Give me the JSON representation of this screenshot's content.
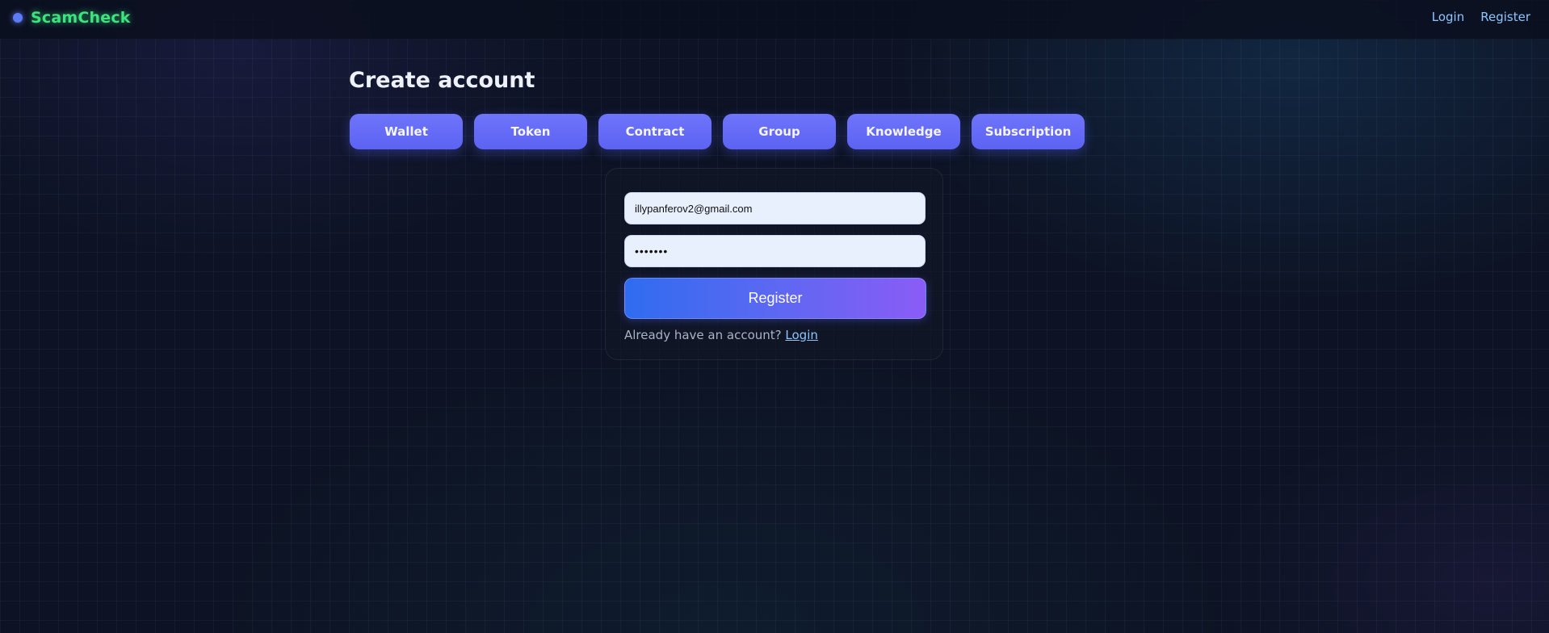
{
  "brand": {
    "name": "ScamCheck",
    "dot_color": "#5b7cf6",
    "name_color": "#3ee27f"
  },
  "nav": {
    "login_label": "Login",
    "register_label": "Register"
  },
  "page": {
    "title": "Create account"
  },
  "tabs": [
    {
      "label": "Wallet"
    },
    {
      "label": "Token"
    },
    {
      "label": "Contract"
    },
    {
      "label": "Group"
    },
    {
      "label": "Knowledge"
    },
    {
      "label": "Subscription"
    }
  ],
  "form": {
    "email_value": "illypanferov2@gmail.com",
    "password_value": "•••••••",
    "submit_label": "Register",
    "login_prompt_text": "Already have an account?",
    "login_link_label": "Login"
  },
  "colors": {
    "background": "#0d1324",
    "tab_accent": "#6366f1",
    "link": "#8ec5ff",
    "button_gradient_start": "#2f6cf0",
    "button_gradient_end": "#8a5cf6"
  }
}
